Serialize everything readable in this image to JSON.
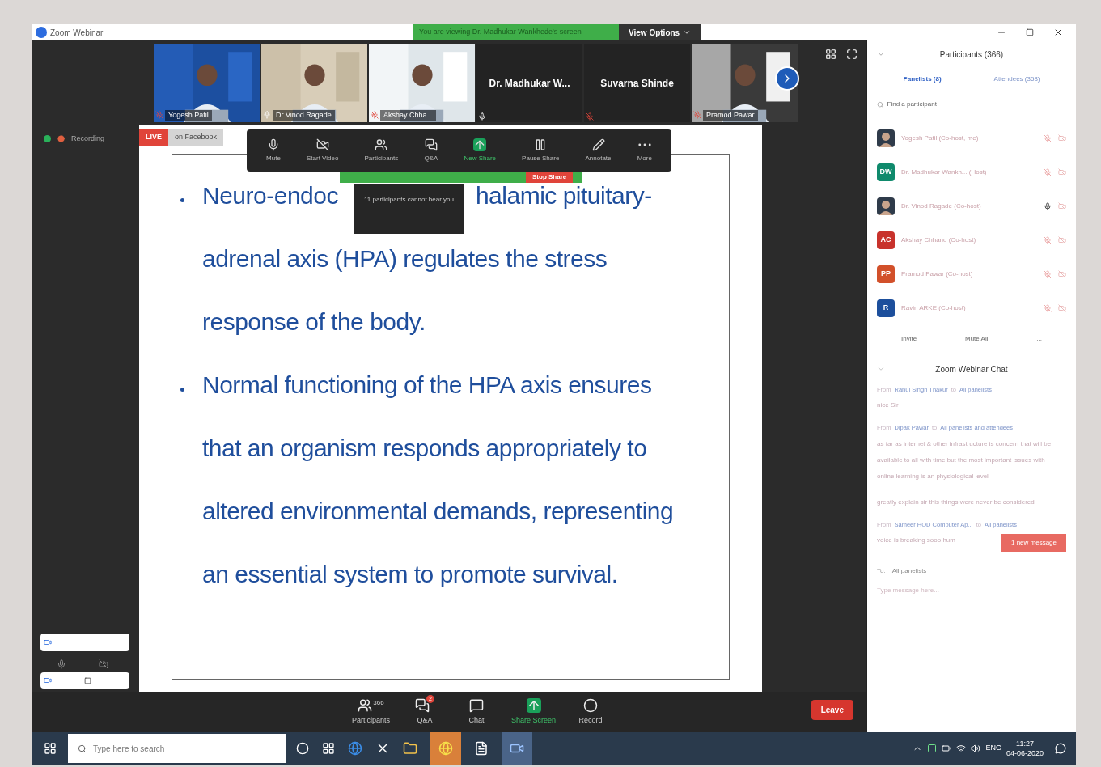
{
  "window": {
    "title": "Zoom Webinar",
    "view_options": "View Options"
  },
  "share_banner": {
    "text": "You are viewing Dr. Madhukar Wankhede's screen"
  },
  "video_strip": [
    {
      "kind": "video",
      "name": "Yogesh Patil",
      "muted": true
    },
    {
      "kind": "video",
      "name": "Dr Vinod Ragade",
      "muted": false
    },
    {
      "kind": "video",
      "name": "Akshay Chha...",
      "muted": true
    },
    {
      "kind": "name",
      "name": "Dr. Madhukar W...",
      "muted": false
    },
    {
      "kind": "name",
      "name": "Suvarna Shinde",
      "muted": true
    },
    {
      "kind": "video",
      "name": "Pramod Pawar",
      "muted": true
    }
  ],
  "status": {
    "recording": "Recording",
    "live": "LIVE",
    "live_target": "on Facebook"
  },
  "share_toolbar": {
    "buttons": [
      {
        "kind": "mic",
        "label": "Mute"
      },
      {
        "kind": "video",
        "label": "Start Video"
      },
      {
        "kind": "participants",
        "label": "Participants"
      },
      {
        "kind": "qa",
        "label": "Q&A"
      },
      {
        "kind": "share",
        "label": "New Share"
      },
      {
        "kind": "pause",
        "label": "Pause Share"
      },
      {
        "kind": "annotate",
        "label": "Annotate"
      },
      {
        "kind": "more",
        "label": "More"
      }
    ],
    "stop_share": "Stop Share"
  },
  "tooltip": "11 participants cannot hear you",
  "slide": {
    "bullets": [
      {
        "lines": [
          [
            "Neuro-endoc",
            "halamic pituitary-"
          ],
          [
            "adrenal axis (HPA) regulates the stress"
          ],
          [
            "response of the body."
          ]
        ]
      },
      {
        "lines": [
          [
            "Normal functioning of the HPA axis ensures"
          ],
          [
            "that an organism responds appropriately to"
          ],
          [
            "altered environmental demands, representing"
          ],
          [
            "an essential system to promote survival."
          ]
        ]
      }
    ]
  },
  "bottom_toolbar": {
    "buttons": [
      {
        "kind": "participants",
        "label": "Participants",
        "count": "366"
      },
      {
        "kind": "qa",
        "label": "Q&A",
        "badge": "2"
      },
      {
        "kind": "chat",
        "label": "Chat"
      },
      {
        "kind": "share",
        "label": "Share Screen"
      },
      {
        "kind": "record",
        "label": "Record"
      }
    ],
    "leave": "Leave"
  },
  "participants_panel": {
    "title": "Participants (366)",
    "tabs": [
      {
        "label": "Panelists (8)",
        "selected": true
      },
      {
        "label": "Attendees (358)",
        "selected": false
      }
    ],
    "search": {
      "placeholder": "Find a participant"
    },
    "participants": [
      {
        "name": "Yogesh Patil (Co-host, me)",
        "muted": true
      },
      {
        "name": "Dr. Madhukar Wankh... (Host)",
        "kind": "initials",
        "initials": "DW",
        "color": "#0f8a6c",
        "muted": true
      },
      {
        "name": "Dr. Vinod Ragade (Co-host)",
        "muted": false
      },
      {
        "name": "Akshay Chhand (Co-host)",
        "kind": "initials",
        "initials": "AC",
        "color": "#c8322c",
        "muted": true
      },
      {
        "name": "Pramod Pawar (Co-host)",
        "kind": "initials",
        "initials": "PP",
        "color": "#d2502a",
        "muted": true
      },
      {
        "name": "Ravin ARKE (Co-host)",
        "kind": "initials",
        "initials": "R",
        "color": "#1d4f9c",
        "muted": true
      }
    ],
    "actions": [
      "Invite",
      "Mute All",
      "..."
    ]
  },
  "chat": {
    "title": "Zoom Webinar Chat",
    "messages": [
      {
        "from_label": "From",
        "sender": "Rahul Singh Thakur",
        "to_label": "to",
        "recipient": "All panelists",
        "text": "nice Sir"
      },
      {
        "from_label": "From",
        "sender": "Dipak Pawar",
        "to_label": "to",
        "recipient": "All panelists and attendees",
        "text": "as far as internet & other infrastructure is concern that will be available to all with time but the most important issues with online learning is an physiological level"
      },
      {
        "text": "greatly explain sir this things were never be considered"
      },
      {
        "from_label": "From",
        "sender": "Sameer HOD Computer Ap...",
        "to_label": "to",
        "recipient": "All panelists",
        "text": "voice is breaking sooo hum"
      }
    ],
    "new_messages": "1 new message",
    "to_label": "To:",
    "to_value": "All panelists",
    "placeholder": "Type message here..."
  },
  "taskbar": {
    "search_placeholder": "Type here to search",
    "language": "ENG",
    "time": "11:27",
    "date": "04-06-2020"
  }
}
